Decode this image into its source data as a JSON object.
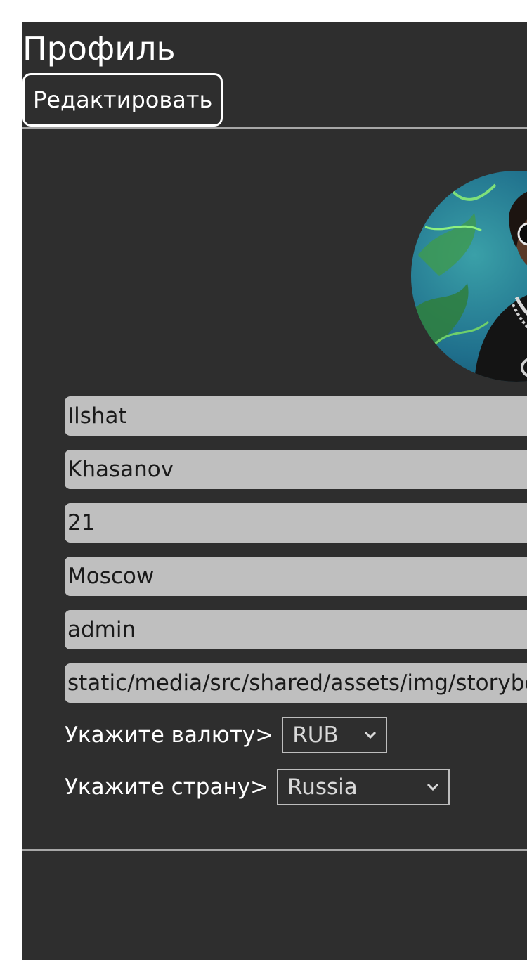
{
  "header": {
    "title": "Профиль",
    "edit_label": "Редактировать"
  },
  "profile": {
    "avatar_icon": "avatar-photo",
    "first_name": "Ilshat",
    "last_name": "Khasanov",
    "age": "21",
    "city": "Moscow",
    "username": "admin",
    "avatar_path": "static/media/src/shared/assets/img/storybook-avatar.jpg"
  },
  "currency": {
    "label": "Укажите валюту>",
    "selected": "RUB"
  },
  "country": {
    "label": "Укажите страну>",
    "selected": "Russia"
  }
}
